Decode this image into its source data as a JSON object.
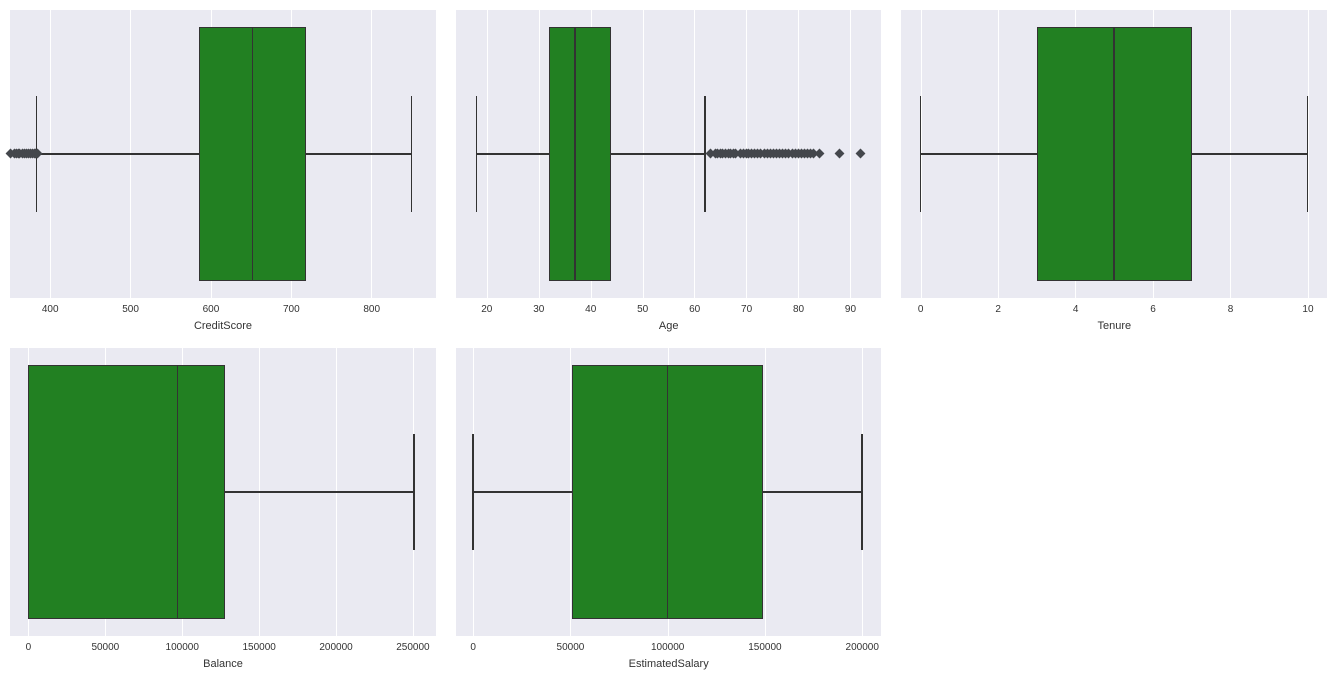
{
  "chart_data": [
    {
      "type": "box",
      "xlabel": "CreditScore",
      "xrange": [
        350,
        880
      ],
      "ticks": [
        400,
        500,
        600,
        700,
        800
      ],
      "q1": 585,
      "median": 652,
      "q3": 718,
      "whisker_low": 383,
      "whisker_high": 850,
      "outliers": [
        350,
        355,
        358,
        360,
        362,
        365,
        368,
        370,
        373,
        376,
        378,
        380,
        382,
        384
      ]
    },
    {
      "type": "box",
      "xlabel": "Age",
      "xrange": [
        14,
        96
      ],
      "ticks": [
        20,
        30,
        40,
        50,
        60,
        70,
        80,
        90
      ],
      "q1": 32,
      "median": 37,
      "q3": 44,
      "whisker_low": 18,
      "whisker_high": 62,
      "outliers": [
        63,
        64,
        64.5,
        65,
        65.5,
        66,
        66.5,
        67,
        67.5,
        68,
        68.8,
        69.4,
        70,
        70.5,
        71,
        71.6,
        72.2,
        72.8,
        73.4,
        74,
        74.6,
        75.2,
        75.8,
        76.4,
        77,
        77.6,
        78.2,
        78.8,
        79.4,
        80,
        80.6,
        81.2,
        81.8,
        82.4,
        83,
        84,
        88,
        92
      ]
    },
    {
      "type": "box",
      "xlabel": "Tenure",
      "xrange": [
        -0.5,
        10.5
      ],
      "ticks": [
        0,
        2,
        4,
        6,
        8,
        10
      ],
      "q1": 3,
      "median": 5,
      "q3": 7,
      "whisker_low": 0,
      "whisker_high": 10,
      "outliers": []
    },
    {
      "type": "box",
      "xlabel": "Balance",
      "xrange": [
        -12000,
        265000
      ],
      "ticks": [
        0,
        50000,
        100000,
        150000,
        200000,
        250000
      ],
      "q1": 0,
      "median": 97000,
      "q3": 128000,
      "whisker_low": 0,
      "whisker_high": 251000,
      "outliers": []
    },
    {
      "type": "box",
      "xlabel": "EstimatedSalary",
      "xrange": [
        -9000,
        210000
      ],
      "ticks": [
        0,
        50000,
        100000,
        150000,
        200000
      ],
      "q1": 51000,
      "median": 100000,
      "q3": 149000,
      "whisker_low": 12,
      "whisker_high": 199992,
      "outliers": []
    }
  ],
  "box_height_pct": 88,
  "cap_height_pct": 40
}
